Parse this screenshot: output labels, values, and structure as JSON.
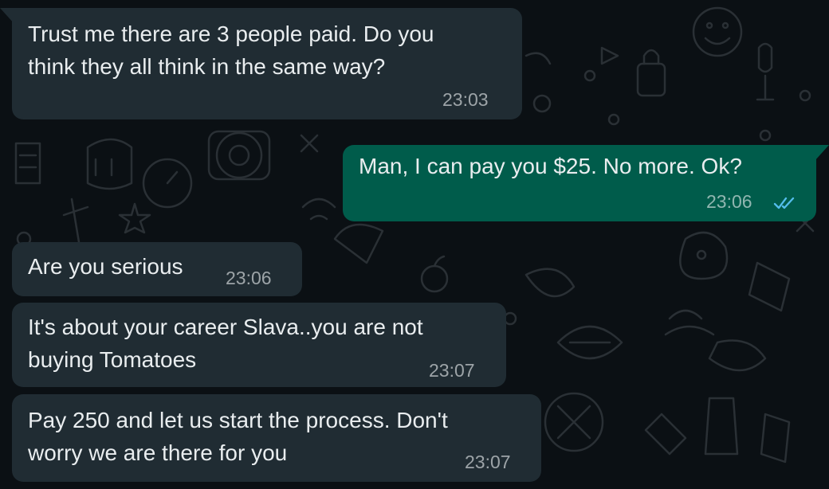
{
  "theme": {
    "incoming_bubble": "#202c33",
    "outgoing_bubble": "#005c4b",
    "read_receipt": "#53bdeb",
    "background": "#0b1014"
  },
  "messages": [
    {
      "direction": "incoming",
      "lines": [
        "Trust me there are 3 people paid. Do you",
        "think they all think in the same way?"
      ],
      "time": "23:03"
    },
    {
      "direction": "outgoing",
      "lines": [
        "Man, I can pay you $25. No more. Ok?"
      ],
      "time": "23:06",
      "status_icon": "double-check-read-icon"
    },
    {
      "direction": "incoming",
      "lines": [
        "Are you serious"
      ],
      "time": "23:06"
    },
    {
      "direction": "incoming",
      "lines": [
        "It's about your career Slava..you are not",
        "buying Tomatoes"
      ],
      "time": "23:07"
    },
    {
      "direction": "incoming",
      "lines": [
        "Pay 250 and let us start the process. Don't",
        "worry we are there for you"
      ],
      "time": "23:07"
    }
  ]
}
